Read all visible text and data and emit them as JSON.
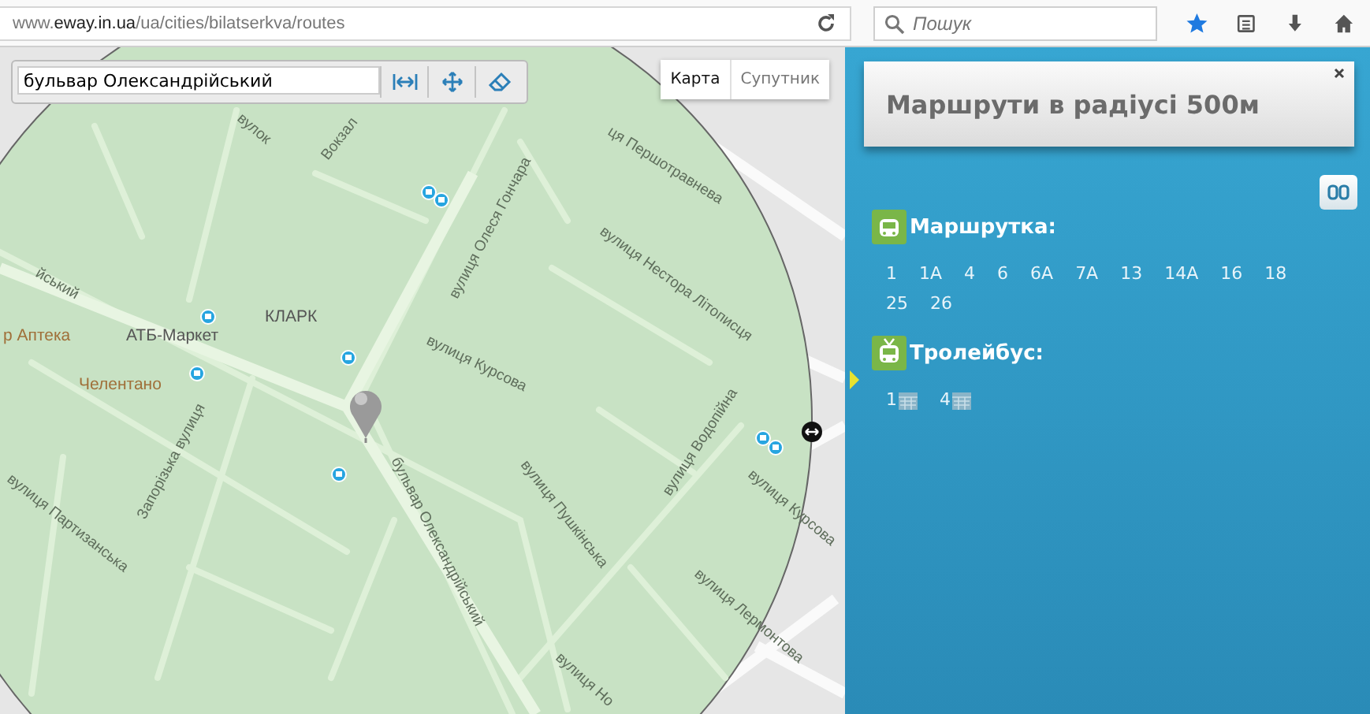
{
  "browser": {
    "url_host_prefix": "www.",
    "url_host": "eway.in.ua",
    "url_path": "/ua/cities/bilatserkva/routes",
    "search": {
      "placeholder": "Пошук"
    }
  },
  "map": {
    "search": {
      "value": "бульвар Олександрійський"
    },
    "map_types": [
      {
        "label": "Карта",
        "selected": true
      },
      {
        "label": "Супутник",
        "selected": false
      }
    ],
    "labels": [
      {
        "text": "вулок",
        "kind": "street"
      },
      {
        "text": "Вокзал",
        "kind": "street"
      },
      {
        "text": "ця Першотравнева",
        "kind": "street"
      },
      {
        "text": "вулиця Олеся Гончара",
        "kind": "street"
      },
      {
        "text": "вулиця Нестора Літописця",
        "kind": "street"
      },
      {
        "text": "йський",
        "kind": "street"
      },
      {
        "text": "КЛАРК",
        "kind": "poi"
      },
      {
        "text": "р Аптека",
        "kind": "poi_food"
      },
      {
        "text": "АТБ-Маркет",
        "kind": "poi"
      },
      {
        "text": "Челентано",
        "kind": "poi_food"
      },
      {
        "text": "вулиця Курсова",
        "kind": "street"
      },
      {
        "text": "бульвар Олександрійський",
        "kind": "street"
      },
      {
        "text": "Запорізька вулиця",
        "kind": "street"
      },
      {
        "text": "вулиця Партизанська",
        "kind": "street"
      },
      {
        "text": "вулиця Пушкінська",
        "kind": "street"
      },
      {
        "text": "вулиця Водопійна",
        "kind": "street"
      },
      {
        "text": "вулиця Курсова",
        "kind": "street"
      },
      {
        "text": "вулиця Лермонтова",
        "kind": "street"
      },
      {
        "text": "вулиця Но",
        "kind": "street"
      }
    ]
  },
  "panel": {
    "title": "Маршрути в радіусі 500м",
    "sections": [
      {
        "kind": "minibus",
        "title": "Маршрутка:",
        "routes": [
          "1",
          "1А",
          "4",
          "6",
          "6А",
          "7А",
          "13",
          "14А",
          "16",
          "18",
          "25",
          "26"
        ]
      },
      {
        "kind": "trolleybus",
        "title": "Тролейбус:",
        "routes": [
          "1",
          "4"
        ]
      }
    ]
  }
}
